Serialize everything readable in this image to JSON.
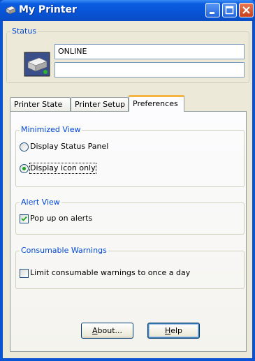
{
  "window": {
    "title": "My Printer"
  },
  "status": {
    "group_label": "Status",
    "line1": "ONLINE",
    "line2": ""
  },
  "tabs": [
    {
      "label": "Printer State",
      "active": false
    },
    {
      "label": "Printer Setup",
      "active": false
    },
    {
      "label": "Preferences",
      "active": true
    }
  ],
  "preferences": {
    "minimized_view": {
      "label": "Minimized View",
      "options": [
        {
          "label": "Display Status Panel",
          "selected": false
        },
        {
          "label": "Display icon only",
          "selected": true
        }
      ]
    },
    "alert_view": {
      "label": "Alert View",
      "checkbox_label": "Pop up on alerts",
      "checked": true
    },
    "consumable_warnings": {
      "label": "Consumable Warnings",
      "checkbox_label": "Limit consumable warnings to once a day",
      "checked": false
    }
  },
  "buttons": {
    "about": {
      "label_access": "A",
      "label_rest": "bout..."
    },
    "help": {
      "label_access": "H",
      "label_rest": "elp"
    }
  },
  "colors": {
    "titlebar": "#0854d6",
    "dialog_bg": "#ece9d8",
    "groupbox_label": "#0046d5",
    "active_tab_accent": "#f5b544",
    "radio_dot": "#21a121"
  }
}
